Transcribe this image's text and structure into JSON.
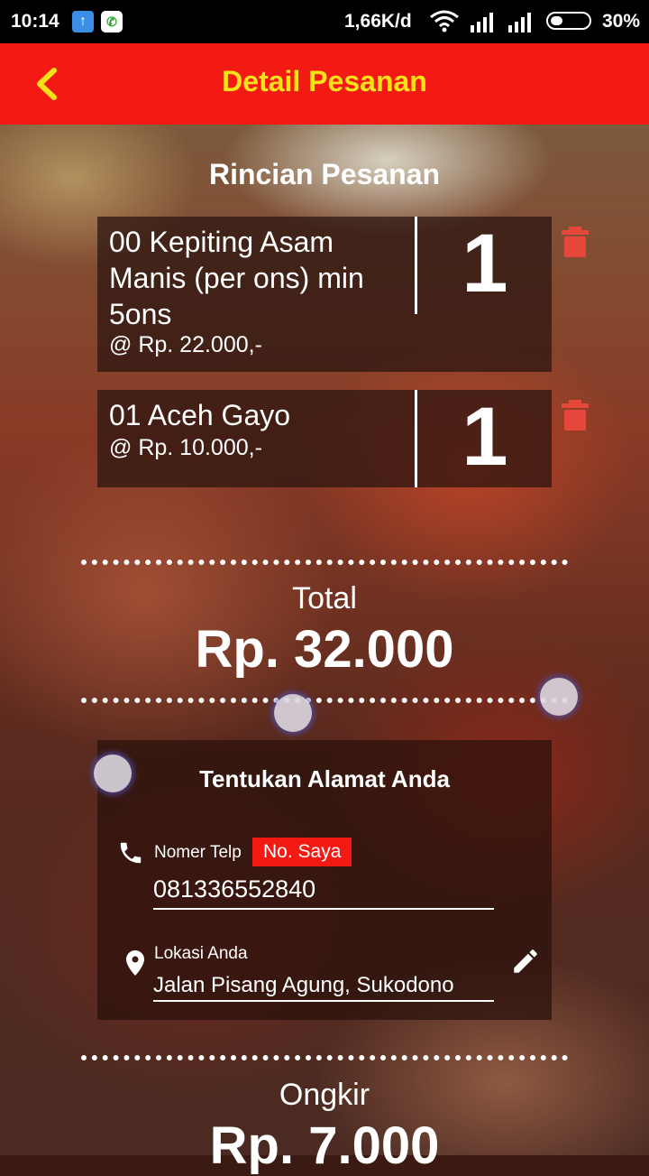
{
  "status_bar": {
    "time": "10:14",
    "speed": "1,66K/d",
    "battery": "30%"
  },
  "app_bar": {
    "title": "Detail Pesanan"
  },
  "order": {
    "section_title": "Rincian Pesanan",
    "items": [
      {
        "name": "00 Kepiting Asam Manis (per ons) min 5ons",
        "price": "@ Rp. 22.000,-",
        "qty": "1"
      },
      {
        "name": "01 Aceh Gayo",
        "price": "@ Rp. 10.000,-",
        "qty": "1"
      }
    ],
    "total_label": "Total",
    "total_value": "Rp. 32.000"
  },
  "address": {
    "title": "Tentukan Alamat Anda",
    "phone_label": "Nomer Telp",
    "my_number_button": "No. Saya",
    "phone_value": "081336552840",
    "location_label": "Lokasi Anda",
    "location_value": "Jalan Pisang Agung, Sukodono"
  },
  "shipping": {
    "label": "Ongkir",
    "value": "Rp. 7.000"
  },
  "colors": {
    "app_bar": "#f21a12",
    "title_yellow": "#f7e21a",
    "trash_red": "#e5483a"
  },
  "icons": [
    "back-chevron-icon",
    "trash-icon",
    "phone-icon",
    "location-pin-icon",
    "pencil-edit-icon",
    "wifi-icon",
    "signal-icon",
    "battery-icon"
  ]
}
